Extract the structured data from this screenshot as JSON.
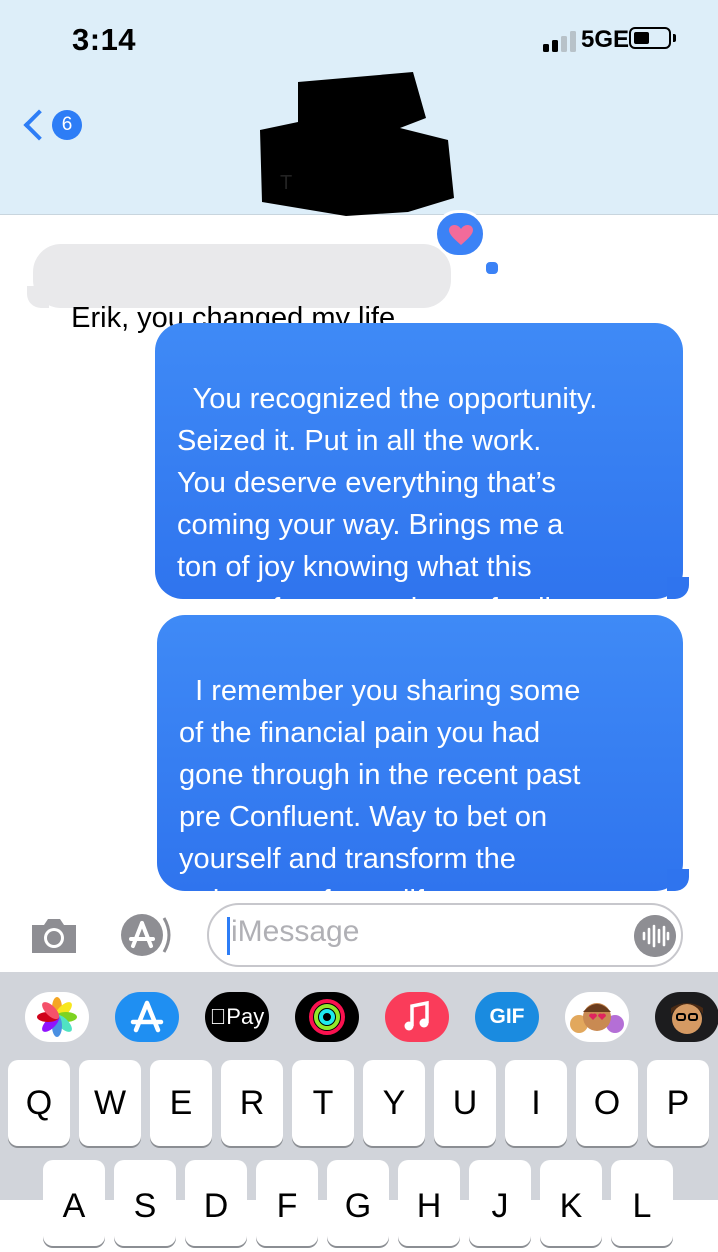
{
  "status_bar": {
    "time": "3:14",
    "network": "5GE",
    "signal_bars_filled": 2,
    "signal_bars_total": 4
  },
  "header": {
    "back_count": "6",
    "contact_name": "T"
  },
  "messages": [
    {
      "direction": "incoming",
      "text": "Erik, you changed my life",
      "reaction": "heart"
    },
    {
      "direction": "outgoing",
      "text": "You recognized the opportunity.\nSeized it. Put in all the work.\nYou deserve everything that’s\ncoming your way. Brings me a\nton of joy knowing what this\nmeans for you and your family."
    },
    {
      "direction": "outgoing",
      "text": "I remember you sharing some\nof the financial pain you had\ngone through in the recent past\npre Confluent. Way to bet on\nyourself and transform the\ntrajectory of your life."
    }
  ],
  "input_bar": {
    "placeholder": "iMessage"
  },
  "app_drawer": {
    "apple_pay_label": "Pay",
    "gif_label": "GIF"
  },
  "keyboard": {
    "row1": [
      "Q",
      "W",
      "E",
      "R",
      "T",
      "Y",
      "U",
      "I",
      "O",
      "P"
    ],
    "row2": [
      "A",
      "S",
      "D",
      "F",
      "G",
      "H",
      "J",
      "K",
      "L"
    ]
  },
  "colors": {
    "accent": "#2d7df6",
    "header_bg": "#ddeef9",
    "incoming_bubble": "#e9e9eb",
    "outgoing_bubble": "#3b82f6",
    "keyboard_bg": "#d1d4da"
  }
}
